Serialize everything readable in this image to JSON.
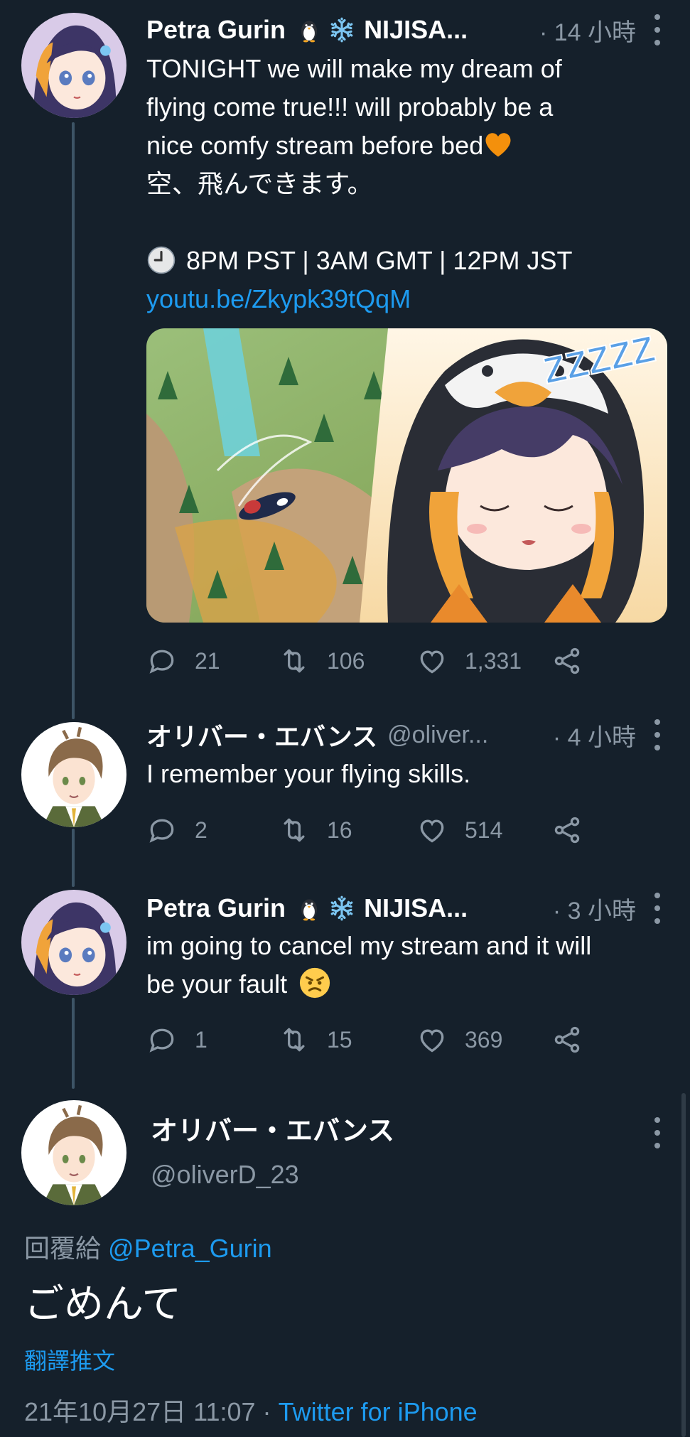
{
  "tweet1": {
    "name": "Petra Gurin",
    "name_suffix": "NIJISA...",
    "time": "· 14 小時",
    "lines": [
      "TONIGHT we will make my dream of",
      "flying come true!!! will probably be a",
      "nice comfy stream before bed",
      "空、飛んできます。",
      "8PM PST | 3AM GMT | 12PM JST"
    ],
    "link": "youtu.be/Zkypk39tQqM",
    "media_caption": "ZZZZZ",
    "reply_count": "21",
    "retweet_count": "106",
    "like_count": "1,331"
  },
  "tweet2": {
    "name": "オリバー・エバンス",
    "handle": "@oliver...",
    "time": "· 4 小時",
    "text": "I remember your flying skills.",
    "reply_count": "2",
    "retweet_count": "16",
    "like_count": "514"
  },
  "tweet3": {
    "name": "Petra Gurin",
    "name_suffix": "NIJISA...",
    "time": "· 3 小時",
    "lines": [
      "im going to cancel my stream and it will",
      "be your fault"
    ],
    "reply_count": "1",
    "retweet_count": "15",
    "like_count": "369"
  },
  "main_tweet": {
    "name": "オリバー・エバンス",
    "handle": "@oliverD_23",
    "reply_prefix": "回覆給",
    "reply_mention": "@Petra_Gurin",
    "text": "ごめんて",
    "translate_label": "翻譯推文",
    "timestamp": "21年10月27日 11:07 ·",
    "source": "Twitter for iPhone"
  },
  "colors": {
    "background": "#15202b",
    "link": "#1d9bf0",
    "secondary_text": "#8b98a5",
    "thread_line": "#3d5466"
  },
  "icons": [
    "reply-icon",
    "retweet-icon",
    "like-icon",
    "share-icon",
    "more-icon",
    "penguin-icon",
    "snowflake-icon",
    "orange-heart-icon",
    "clock-icon",
    "angry-face-icon"
  ]
}
